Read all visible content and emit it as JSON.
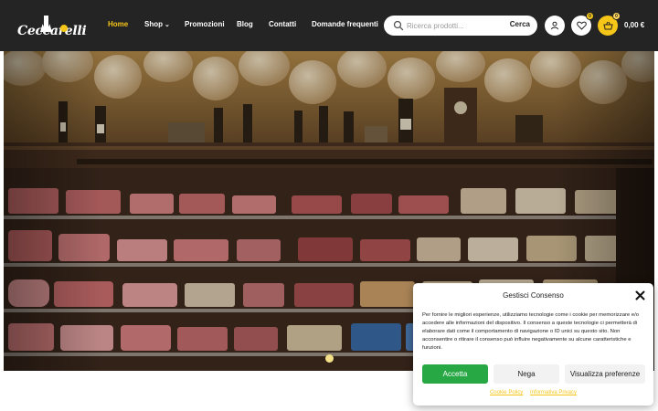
{
  "header": {
    "logo_text": "Ceccarelli",
    "nav": [
      {
        "label": "Home",
        "active": true
      },
      {
        "label": "Shop",
        "active": false
      },
      {
        "label": "Promozioni",
        "active": false
      },
      {
        "label": "Blog",
        "active": false
      },
      {
        "label": "Contatti",
        "active": false
      },
      {
        "label": "Domande frequenti",
        "active": false
      }
    ],
    "shop_chevron": "⌄",
    "search": {
      "placeholder": "Ricerca prodotti...",
      "button_label": "Cerca"
    },
    "wishlist_count": "0",
    "cart_count": "0",
    "cart_total": "0,00 €"
  },
  "hero": {
    "image_subject": "deli-shop-interior-hams-and-cured-meats",
    "slider": {
      "dots": 2,
      "active_index": 0
    }
  },
  "consent": {
    "title": "Gestisci Consenso",
    "text": "Per fornire le migliori esperienze, utilizziamo tecnologie come i cookie per memorizzare e/o accedere alle informazioni del dispositivo. Il consenso a queste tecnologie ci permetterà di elaborare dati come il comportamento di navigazione o ID unici su questo sito. Non acconsentire o ritirare il consenso può influire negativamente su alcune caratteristiche e funzioni.",
    "accept_label": "Accetta",
    "deny_label": "Nega",
    "prefs_label": "Visualizza preferenze",
    "link_cookie": "Cookie Policy",
    "link_privacy": "Informativa Privacy"
  },
  "colors": {
    "header_bg": "#242424",
    "accent": "#f5c518",
    "accept_green": "#28a745"
  }
}
